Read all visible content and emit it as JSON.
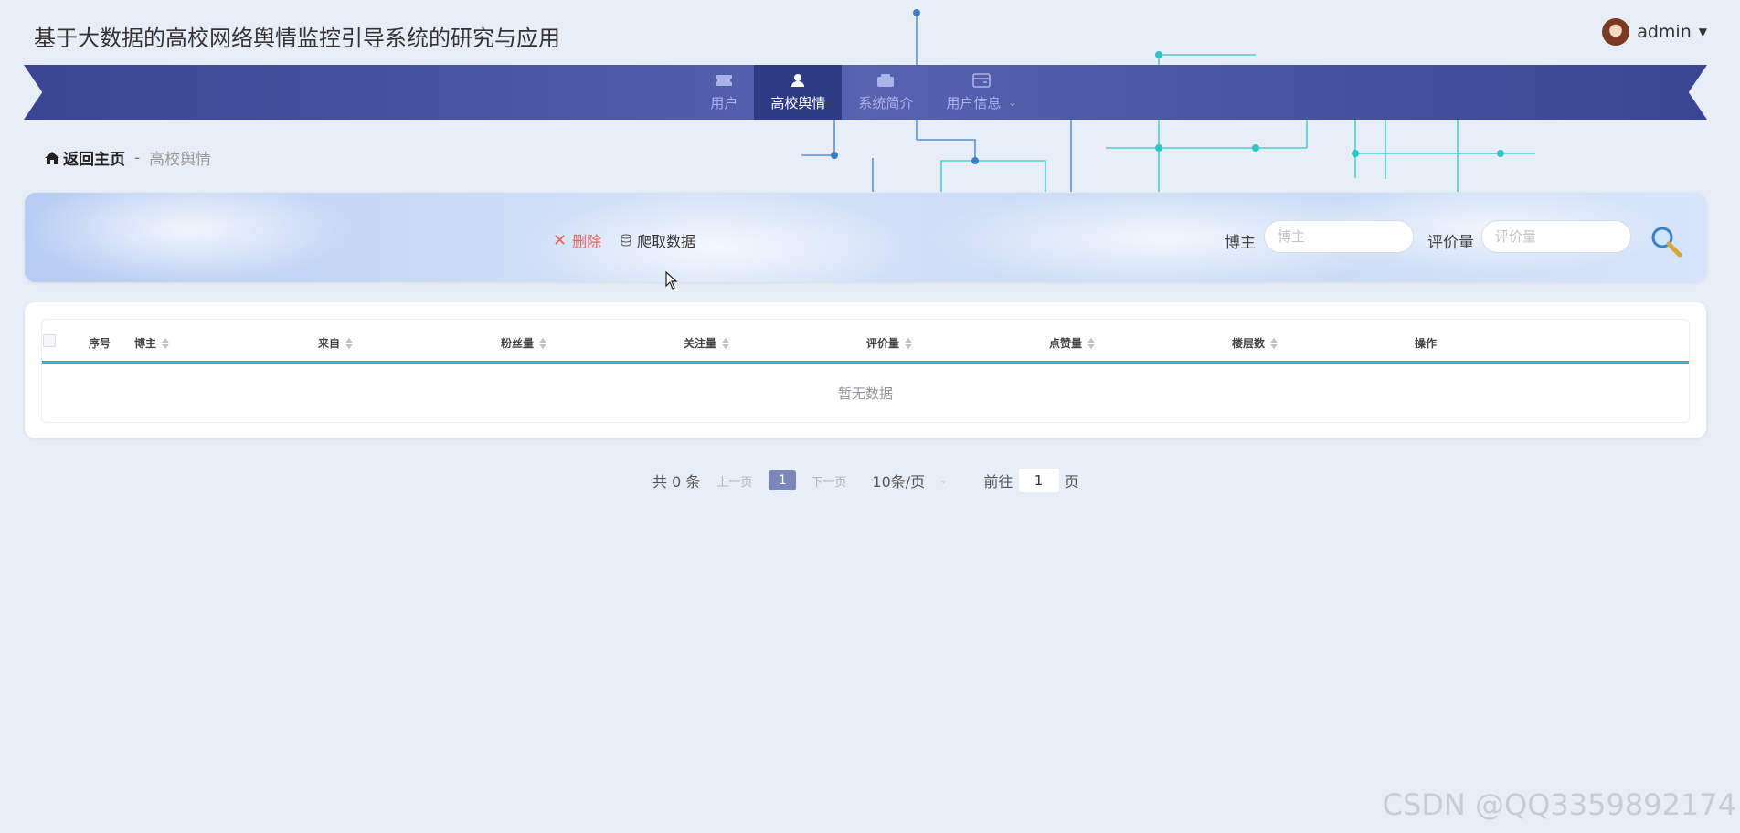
{
  "app": {
    "title": "基于大数据的高校网络舆情监控引导系统的研究与应用"
  },
  "user": {
    "name": "admin"
  },
  "nav": {
    "items": [
      {
        "label": "用户",
        "icon": "ticket-icon",
        "active": false
      },
      {
        "label": "高校舆情",
        "icon": "user-icon",
        "active": true
      },
      {
        "label": "系统简介",
        "icon": "wallet-icon",
        "active": false
      },
      {
        "label": "用户信息",
        "icon": "card-icon",
        "active": false
      }
    ]
  },
  "breadcrumb": {
    "home": "返回主页",
    "separator": "-",
    "current": "高校舆情"
  },
  "toolbar": {
    "delete_label": "删除",
    "crawl_label": "爬取数据",
    "blogger_label": "博主",
    "blogger_placeholder": "博主",
    "comments_label": "评价量",
    "comments_placeholder": "评价量"
  },
  "table": {
    "columns": [
      "序号",
      "博主",
      "来自",
      "粉丝量",
      "关注量",
      "评价量",
      "点赞量",
      "楼层数",
      "操作"
    ],
    "empty_text": "暂无数据"
  },
  "pagination": {
    "total": "共 0 条",
    "prev": "上一页",
    "current_page": "1",
    "next": "下一页",
    "page_size": "10条/页",
    "goto_prefix": "前往",
    "goto_value": "1",
    "goto_suffix": "页"
  },
  "watermark": "CSDN @QQ3359892174",
  "colors": {
    "nav_bg": "#4a56a6",
    "nav_active": "#2d3a84",
    "table_header_border": "#32b0d8",
    "delete": "#e86060",
    "page_active": "#7a87b8"
  }
}
